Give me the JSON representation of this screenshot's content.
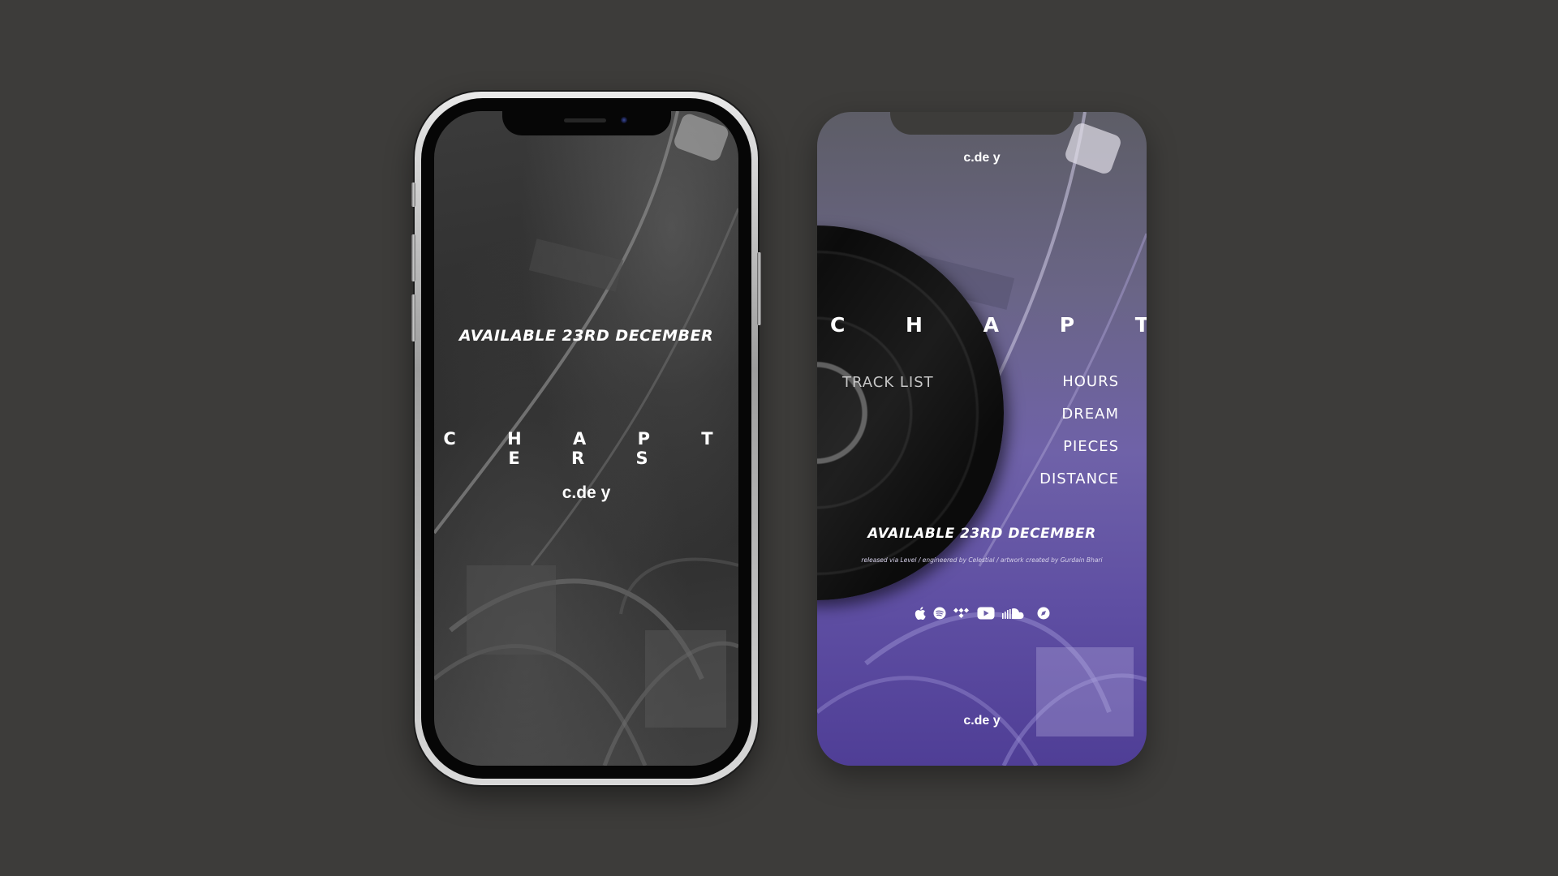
{
  "left_screen": {
    "availability": "AVAILABLE 23RD DECEMBER",
    "title": "C H A P T E R S",
    "artist": "c.de y"
  },
  "right_screen": {
    "artist_top": "c.de y",
    "title": "C H A P T E R S",
    "tracklist_label": "TRACK LIST",
    "tracks": [
      "HOURS",
      "DREAM",
      "PIECES",
      "DISTANCE"
    ],
    "availability": "AVAILABLE 23RD DECEMBER",
    "credits": "released via Level / engineered by Celestial / artwork created by Gurdain Bhari",
    "platform_icons": [
      "apple-music-icon",
      "spotify-icon",
      "tidal-icon",
      "youtube-icon",
      "soundcloud-icon",
      "deezer-icon"
    ],
    "artist_bottom": "c.de y"
  },
  "colors": {
    "background": "#3d3c3a",
    "purple_gradient_end": "#4f3e96",
    "text": "#ffffff"
  }
}
